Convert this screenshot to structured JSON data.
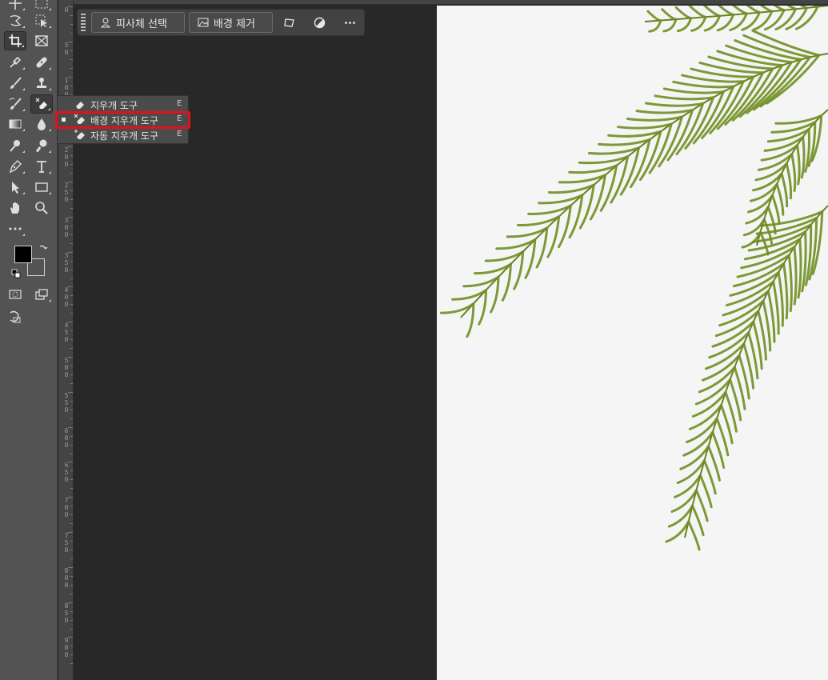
{
  "taskbar": {
    "select_subject_label": "피사체 선택",
    "remove_background_label": "배경 제거"
  },
  "flyout": {
    "items": [
      {
        "label": "지우개 도구",
        "shortcut": "E"
      },
      {
        "label": "배경 지우개 도구",
        "shortcut": "E"
      },
      {
        "label": "자동 지우개 도구",
        "shortcut": "E"
      }
    ]
  },
  "ruler": {
    "vertical_labels": [
      "0",
      "50",
      "100",
      "150",
      "200",
      "250",
      "300",
      "350",
      "400",
      "450",
      "500",
      "550",
      "600",
      "650",
      "700",
      "750",
      "800",
      "850",
      "900"
    ]
  },
  "colors": {
    "foreground": "#000000",
    "background": "#535353",
    "highlight": "#e0121a",
    "palm": "#6f8f22"
  },
  "icons": [
    "move-icon",
    "marquee-icon",
    "lasso-icon",
    "object-select-icon",
    "crop-icon",
    "frame-icon",
    "eyedropper-icon",
    "healing-brush-icon",
    "brush-icon",
    "stamp-icon",
    "history-brush-icon",
    "eraser-icon",
    "gradient-icon",
    "blur-icon",
    "dodge-icon",
    "smudge-icon",
    "pen-icon",
    "type-icon",
    "path-select-icon",
    "rectangle-icon",
    "hand-icon",
    "zoom-icon",
    "more-icon"
  ]
}
